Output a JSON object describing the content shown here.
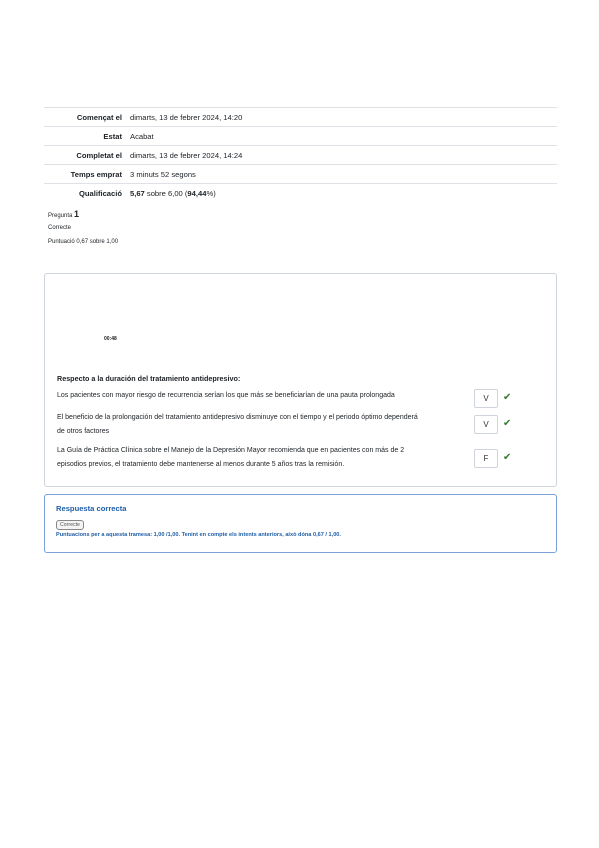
{
  "summary": [
    {
      "label": "Començat el",
      "value": "dimarts, 13 de febrer 2024, 14:20"
    },
    {
      "label": "Estat",
      "value": "Acabat"
    },
    {
      "label": "Completat el",
      "value": "dimarts, 13 de febrer 2024, 14:24"
    },
    {
      "label": "Temps emprat",
      "value": "3 minuts 52 segons"
    },
    {
      "label": "Qualificació",
      "value_strong": "5,67",
      "value_mid": " sobre 6,00 (",
      "value_pct": "94,44",
      "value_end": "%)"
    }
  ],
  "question": {
    "number_label": "Pregunta",
    "number": "1",
    "state": "Correcte",
    "grade": "Puntuació 0,67 sobre 1,00",
    "timer": "00:48",
    "text": "Respecto a la duración del tratamiento antidepresivo:",
    "rows": [
      {
        "line1": "Los pacientes con mayor riesgo de recurrencia serían los que más se beneficiarían de una pauta prolongada",
        "line2": "",
        "selected": "V"
      },
      {
        "line1": "El beneficio de la prolongación del tratamiento antidepresivo disminuye con el tiempo y el periodo óptimo dependerá",
        "line2": "de otros factores",
        "selected": "V"
      },
      {
        "line1": "La Guía de Práctica Clínica sobre el Manejo de la Depresión Mayor recomienda que en pacientes con más de 2",
        "line2": "episodios previos, el tratamiento debe mantenerse al menos durante 5 años tras la remisión.",
        "selected": "F"
      }
    ],
    "check_icon": "check-icon",
    "check_color": "#357a32"
  },
  "outcome": {
    "title": "Respuesta correcta",
    "badge": "Correcte",
    "marks": "Puntuacions per a aquesta tramesa: 1,00 /1,00. Tenint en compte els intents anteriors, això dóna 0,67 / 1,00."
  }
}
